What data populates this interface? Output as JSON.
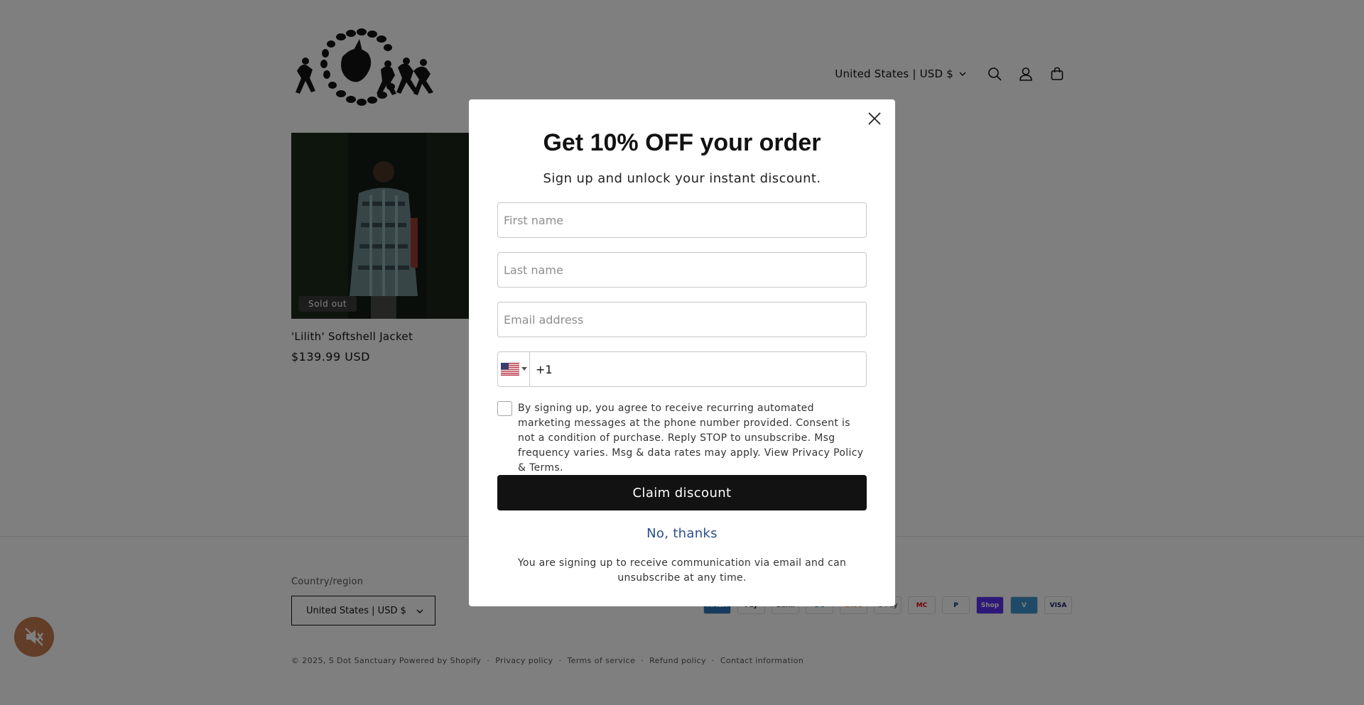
{
  "header": {
    "country_label": "United States | USD $",
    "icons": [
      "search-icon",
      "account-icon",
      "cart-icon"
    ]
  },
  "product": {
    "badge": "Sold out",
    "title": "'Lilith' Softshell Jacket",
    "price": "$139.99 USD"
  },
  "footer": {
    "country_heading": "Country/region",
    "country_value": "United States | USD $",
    "payments": [
      {
        "label": "AMEX",
        "bg": "#2e77bc",
        "fg": "#ffffff"
      },
      {
        "label": "Pay",
        "bg": "#ffffff",
        "fg": "#000000"
      },
      {
        "label": "Bank",
        "bg": "#ffffff",
        "fg": "#333333"
      },
      {
        "label": "DC",
        "bg": "#ffffff",
        "fg": "#0079be"
      },
      {
        "label": "DISC",
        "bg": "#ffffff",
        "fg": "#f58220"
      },
      {
        "label": "G Pay",
        "bg": "#ffffff",
        "fg": "#5f6368"
      },
      {
        "label": "MC",
        "bg": "#ffffff",
        "fg": "#eb001b"
      },
      {
        "label": "P",
        "bg": "#ffffff",
        "fg": "#003087"
      },
      {
        "label": "Shop",
        "bg": "#5a31f4",
        "fg": "#ffffff"
      },
      {
        "label": "V",
        "bg": "#3d95ce",
        "fg": "#ffffff"
      },
      {
        "label": "VISA",
        "bg": "#ffffff",
        "fg": "#1a1f71"
      }
    ],
    "copyright": "© 2025,",
    "store_link": "S Dot Sanctuary",
    "powered": "Powered by Shopify",
    "links": [
      "Privacy policy",
      "Terms of service",
      "Refund policy",
      "Contact information"
    ]
  },
  "modal": {
    "title": "Get 10% OFF your order",
    "subtitle": "Sign up and unlock your instant discount.",
    "first_name_placeholder": "First name",
    "last_name_placeholder": "Last name",
    "email_placeholder": "Email address",
    "phone_value": "+1",
    "consent_text": "By signing up, you agree to receive recurring automated marketing messages at the phone number provided. Consent is not a condition of purchase. Reply STOP to unsubscribe. Msg frequency varies. Msg & data rates may apply. View Privacy Policy & Terms.",
    "claim_label": "Claim discount",
    "decline_label": "No, thanks",
    "disclaimer": "You are signing up to receive communication via email and can unsubscribe at any time."
  },
  "colors": {
    "accent": "#121212",
    "link": "#2b4d8f",
    "overlay": "rgba(0,0,0,0.5)"
  }
}
